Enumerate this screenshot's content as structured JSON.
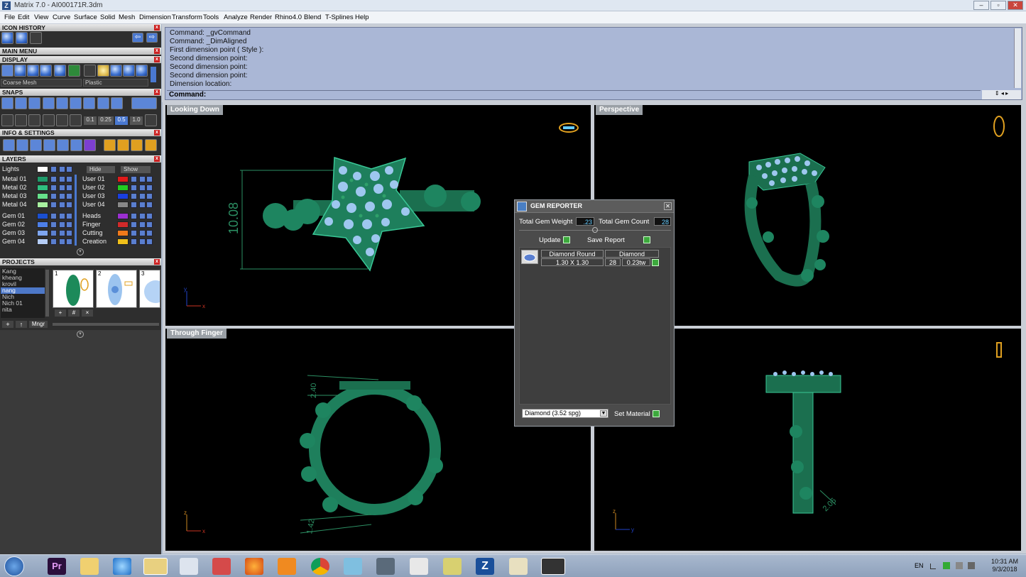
{
  "window": {
    "title": "Matrix 7.0 - AI000171R.3dm",
    "icon": "Z"
  },
  "menu": [
    "File",
    "Edit",
    "View",
    "Curve",
    "Surface",
    "Solid",
    "Mesh",
    "Dimension",
    "Transform",
    "Tools",
    "Analyze",
    "Render",
    "Rhino4.0",
    "Blend",
    "T-Splines",
    "Help"
  ],
  "left": {
    "icon_history": "ICON HISTORY",
    "main_menu": "MAIN MENU",
    "display": "DISPLAY",
    "display_mesh": "Coarse Mesh",
    "display_material": "Plastic",
    "snaps": "SNAPS",
    "snap_values": [
      "0.1",
      "0.25",
      "0.5",
      "1.0"
    ],
    "info_settings": "INFO & SETTINGS",
    "layers": "LAYERS",
    "lights": "Lights",
    "hide": "Hide",
    "show": "Show",
    "layers_left": [
      {
        "name": "Metal 01",
        "color": "#1f9a6a"
      },
      {
        "name": "Metal 02",
        "color": "#2fbf7f"
      },
      {
        "name": "Metal 03",
        "color": "#66e08a"
      },
      {
        "name": "Metal 04",
        "color": "#a8f0a0"
      },
      {
        "name": "Gem 01",
        "color": "#1a4fd0"
      },
      {
        "name": "Gem 02",
        "color": "#4d7fe8"
      },
      {
        "name": "Gem 03",
        "color": "#7ea6f0"
      },
      {
        "name": "Gem 04",
        "color": "#b5cdf6"
      }
    ],
    "layers_right": [
      {
        "name": "User 01",
        "color": "#e01a1a"
      },
      {
        "name": "User 02",
        "color": "#22cc22"
      },
      {
        "name": "User 03",
        "color": "#1a3fe0"
      },
      {
        "name": "User 04",
        "color": "#888888"
      },
      {
        "name": "Heads",
        "color": "#9a2fd0"
      },
      {
        "name": "Finger",
        "color": "#d02a2a"
      },
      {
        "name": "Cutting",
        "color": "#f07a1a"
      },
      {
        "name": "Creation",
        "color": "#f0c01a"
      }
    ],
    "projects": "PROJECTS",
    "project_list": [
      "Kang",
      "kheang",
      "krovil",
      "nang",
      "Nich",
      "Nich 01",
      "nita"
    ],
    "project_selected": 3,
    "thumb_numbers": [
      "1",
      "2",
      "3"
    ],
    "mngr": "Mngr"
  },
  "command": {
    "history": [
      "Command: _gvCommand",
      "Command: _DimAligned",
      "First dimension point ( Style ):",
      "Second dimension point:",
      "Second dimension point:",
      "Second dimension point:",
      "Dimension location:"
    ],
    "prompt": "Command:"
  },
  "viewports": {
    "top_left": {
      "label": "Looking Down",
      "dim": "10.08"
    },
    "top_right": {
      "label": "Perspective"
    },
    "bottom_left": {
      "label": "Through Finger",
      "dim_top": "2.40",
      "dim_bottom": "1.42"
    },
    "bottom_right": {
      "label": "",
      "dim": "2.06"
    }
  },
  "gem_reporter": {
    "title": "GEM REPORTER",
    "weight_label": "Total Gem Weight",
    "weight_value": ".23",
    "count_label": "Total Gem Count",
    "count_value": "28",
    "update": "Update",
    "save_report": "Save Report",
    "col1": "Diamond Round",
    "col2": "Diamond",
    "size": "1.30 X 1.30",
    "qty": "28",
    "tw": "0.23tw",
    "material": "Diamond     (3.52 spg)",
    "set_material": "Set Material"
  },
  "taskbar": {
    "lang": "EN",
    "time": "10:31 AM",
    "date": "9/3/2018",
    "apps": [
      "premiere-icon",
      "folder-icon",
      "ie-icon",
      "explorer-icon",
      "calculator-icon",
      "snipping-icon",
      "firefox-icon",
      "media-icon",
      "chrome-icon",
      "eraser-icon",
      "pen-tool-icon",
      "zbrush-icon",
      "notes-icon",
      "matrix-icon",
      "paint-icon",
      "capture-icon"
    ]
  }
}
